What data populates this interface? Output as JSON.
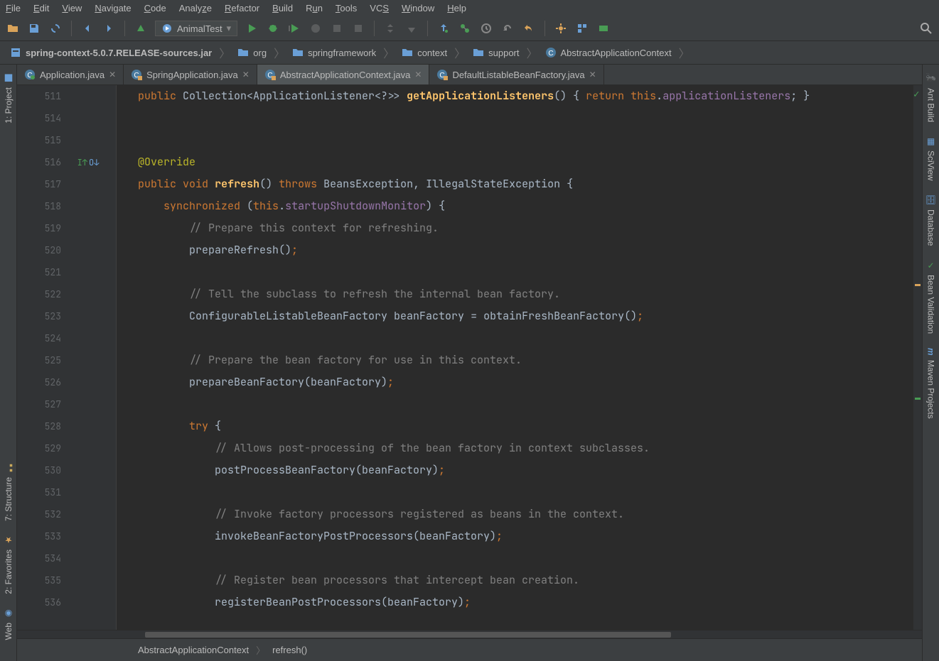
{
  "menu": [
    "File",
    "Edit",
    "View",
    "Navigate",
    "Code",
    "Analyze",
    "Refactor",
    "Build",
    "Run",
    "Tools",
    "VCS",
    "Window",
    "Help"
  ],
  "runConfig": "AnimalTest",
  "breadcrumbs": [
    {
      "icon": "jar",
      "label": "spring-context-5.0.7.RELEASE-sources.jar"
    },
    {
      "icon": "folder",
      "label": "org"
    },
    {
      "icon": "folder",
      "label": "springframework"
    },
    {
      "icon": "folder",
      "label": "context"
    },
    {
      "icon": "folder",
      "label": "support"
    },
    {
      "icon": "class",
      "label": "AbstractApplicationContext"
    }
  ],
  "tabs": [
    {
      "label": "Application.java",
      "active": false
    },
    {
      "label": "SpringApplication.java",
      "active": false
    },
    {
      "label": "AbstractApplicationContext.java",
      "active": true
    },
    {
      "label": "DefaultListableBeanFactory.java",
      "active": false
    }
  ],
  "leftTools": [
    "1: Project",
    "7: Structure",
    "2: Favorites",
    "Web"
  ],
  "rightTools": [
    "Ant Build",
    "SciView",
    "Database",
    "Bean Validation",
    "Maven Projects"
  ],
  "lineStart": 511,
  "lineEnd": 536,
  "code": {
    "l511": {
      "kw1": "public",
      "type1": "Collection",
      "generic": "<ApplicationListener<?>>",
      "method": "getApplicationListeners",
      "paren": "()",
      "brace": " { ",
      "kw2": "return",
      "this": "this",
      "dot": ".",
      "field": "applicationListeners",
      "end": "; }"
    },
    "l515": "@Override",
    "l516": {
      "kw1": "public",
      "kw2": "void",
      "method": "refresh",
      "paren": "()",
      "kw3": "throws",
      "ex": "BeansException, IllegalStateException {"
    },
    "l517": {
      "kw": "synchronized",
      "open": " (",
      "this": "this",
      "dot": ".",
      "field": "startupShutdownMonitor",
      "close": ") {"
    },
    "l518": "// Prepare this context for refreshing.",
    "l519": {
      "call": "prepareRefresh",
      "paren": "()",
      "end": ";"
    },
    "l521": "// Tell the subclass to refresh the internal bean factory.",
    "l522": {
      "type": "ConfigurableListableBeanFactory",
      "var": "beanFactory",
      "eq": " = ",
      "call": "obtainFreshBeanFactory",
      "paren": "()",
      "end": ";"
    },
    "l524": "// Prepare the bean factory for use in this context.",
    "l525": {
      "call": "prepareBeanFactory",
      "arg": "(beanFactory)",
      "end": ";"
    },
    "l527": {
      "kw": "try",
      "brace": " {"
    },
    "l528": "// Allows post-processing of the bean factory in context subclasses.",
    "l529": {
      "call": "postProcessBeanFactory",
      "arg": "(beanFactory)",
      "end": ";"
    },
    "l531": "// Invoke factory processors registered as beans in the context.",
    "l532": {
      "call": "invokeBeanFactoryPostProcessors",
      "arg": "(beanFactory)",
      "end": ";"
    },
    "l534": "// Register bean processors that intercept bean creation.",
    "l535": {
      "call": "registerBeanPostProcessors",
      "arg": "(beanFactory)",
      "end": ";"
    }
  },
  "bottomCrumbs": [
    "AbstractApplicationContext",
    "refresh()"
  ]
}
